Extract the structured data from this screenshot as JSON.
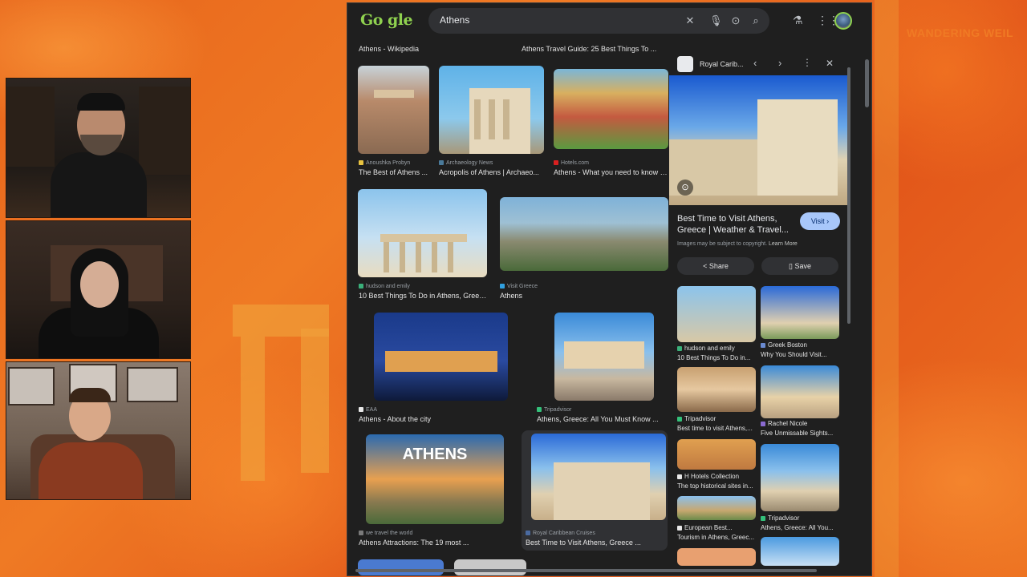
{
  "overlay_brand": "WANDERING WEIL",
  "google": {
    "logo": "Go gle",
    "search_value": "Athens",
    "icons": [
      "close-icon",
      "mic-icon",
      "lens-icon",
      "search-icon",
      "labs-icon",
      "apps-icon",
      "avatar"
    ]
  },
  "results": {
    "top_titles": [
      "Athens - Wikipedia",
      "Athens Travel Guide: 25 Best Things To ..."
    ],
    "row1": [
      {
        "source": "Anoushka Probyn",
        "title": "The Best of Athens ..."
      },
      {
        "source": "Archaeology News",
        "title": "Acropolis of Athens | Archaeo..."
      },
      {
        "source": "Hotels.com",
        "title": "Athens - What you need to know b..."
      }
    ],
    "row2": [
      {
        "source": "hudson and emily",
        "title": "10 Best Things To Do in Athens, Greec..."
      },
      {
        "source": "Visit Greece",
        "title": "Athens"
      }
    ],
    "row3": [
      {
        "source": "EAA",
        "title": "Athens - About the city"
      },
      {
        "source": "Tripadvisor",
        "title": "Athens, Greece: All You Must Know ..."
      }
    ],
    "row4": [
      {
        "source": "we travel the world",
        "title": "Athens Attractions: The 19 most ...",
        "overlay": "ATHENS"
      },
      {
        "source": "Royal Caribbean Cruises",
        "title": "Best Time to Visit Athens, Greece ..."
      }
    ]
  },
  "panel": {
    "source": "Royal Carib...",
    "title": "Best Time to Visit Athens, Greece | Weather & Travel...",
    "visit": "Visit",
    "copyright": "Images may be subject to copyright.",
    "learn_more": "Learn More",
    "share": "Share",
    "save": "Save",
    "related": [
      {
        "source": "hudson and emily",
        "title": "10 Best Things To Do in..."
      },
      {
        "source": "Greek Boston",
        "title": "Why You Should Visit..."
      },
      {
        "source": "Tripadvisor",
        "title": "Best time to visit Athens,..."
      },
      {
        "source": "Rachel Nicole",
        "title": "Five Unmissable Sights..."
      },
      {
        "source": "H Hotels Collection",
        "title": "The top historical sites in..."
      },
      {
        "source": "Tripadvisor",
        "title": "Athens, Greece: All You..."
      },
      {
        "source": "European Best...",
        "title": "Tourism in Athens, Greec..."
      }
    ]
  }
}
